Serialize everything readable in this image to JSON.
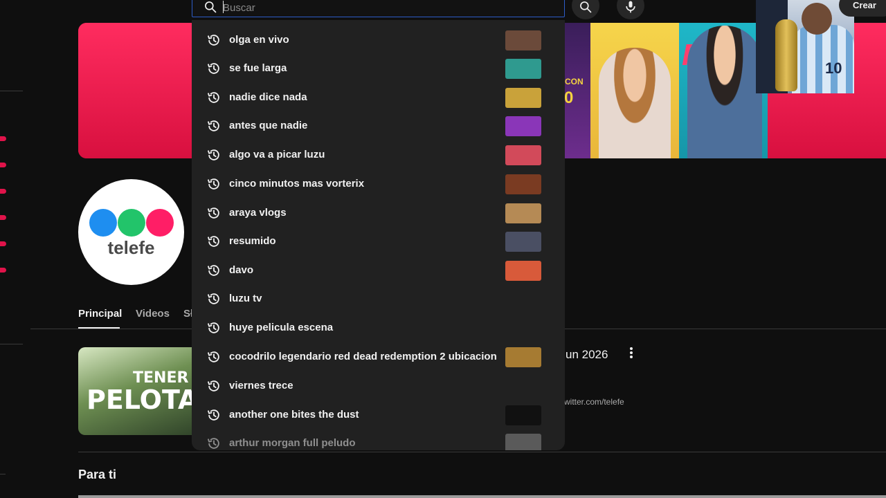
{
  "search": {
    "placeholder": "Buscar"
  },
  "header": {
    "create_label": "Crear"
  },
  "banner": {
    "promo_text": "CON",
    "promo_number": "0",
    "teal_text": "R"
  },
  "channel": {
    "avatar_text": "telefe",
    "logo_colors": [
      "#1e8ef0",
      "#22c46a",
      "#ff1e66"
    ]
  },
  "tabs": [
    {
      "label": "Principal"
    },
    {
      "label": "Videos"
    },
    {
      "label": "Sł"
    }
  ],
  "featured": {
    "thumb_line1": "TENER",
    "thumb_line2": "PELOTA",
    "title_tail": "un 2026",
    "link_tail": "witter.com/telefe"
  },
  "sections": {
    "para_ti": "Para ti"
  },
  "suggestions": [
    {
      "label": "olga en vivo",
      "thumb_color": "#6b4a3a"
    },
    {
      "label": "se fue larga",
      "thumb_color": "#2f9a8f"
    },
    {
      "label": "nadie dice nada",
      "thumb_color": "#c9a23a"
    },
    {
      "label": "antes que nadie",
      "thumb_color": "#8a36b8"
    },
    {
      "label": "algo va a picar luzu",
      "thumb_color": "#d24a5a"
    },
    {
      "label": "cinco minutos mas vorterix",
      "thumb_color": "#7a3b22"
    },
    {
      "label": "araya vlogs",
      "thumb_color": "#b58a55"
    },
    {
      "label": "resumido",
      "thumb_color": "#4a4f63"
    },
    {
      "label": "davo",
      "thumb_color": "#d85a3a"
    },
    {
      "label": "luzu tv",
      "thumb_color": ""
    },
    {
      "label": "huye pelicula escena",
      "thumb_color": ""
    },
    {
      "label": "cocodrilo legendario red dead redemption 2 ubicacion",
      "thumb_color": "#a67b32"
    },
    {
      "label": "viernes trece",
      "thumb_color": ""
    },
    {
      "label": "another one bites the dust",
      "thumb_color": "#111111"
    },
    {
      "label": "arthur morgan full peludo",
      "thumb_color": "#5a5a5a"
    }
  ]
}
